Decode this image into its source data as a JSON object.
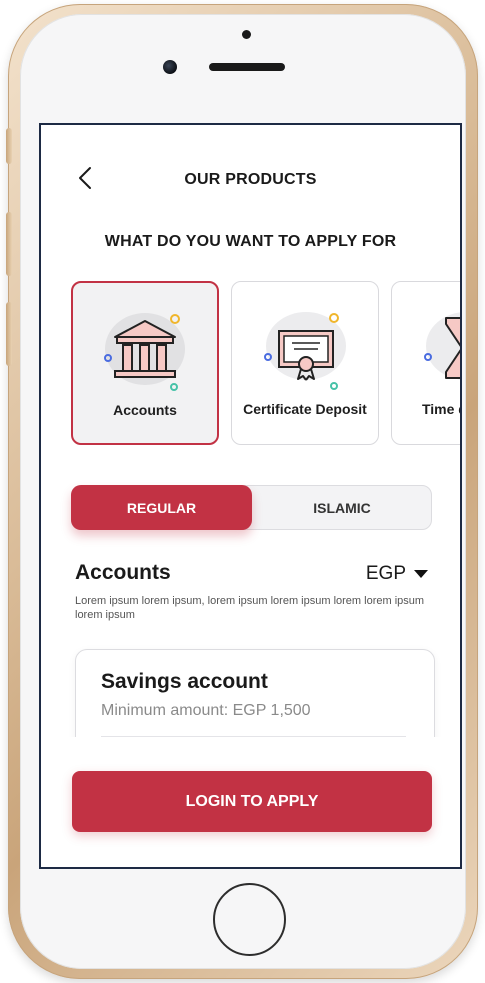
{
  "header": {
    "title": "OUR PRODUCTS",
    "back_icon": "chevron-left-icon"
  },
  "subtitle": "WHAT DO YOU WANT TO APPLY FOR",
  "products": [
    {
      "label": "Accounts",
      "icon": "bank-icon",
      "selected": true
    },
    {
      "label": "Certificate Deposit",
      "icon": "certificate-icon",
      "selected": false
    },
    {
      "label": "Time deposit",
      "visible_label": "T dep",
      "icon": "hourglass-icon",
      "selected": false
    }
  ],
  "segment": {
    "options": [
      "REGULAR",
      "ISLAMIC"
    ],
    "selected": "REGULAR"
  },
  "section": {
    "title": "Accounts",
    "currency": "EGP",
    "description": "Lorem ipsum lorem ipsum, lorem ipsum lorem ipsum lorem lorem ipsum lorem ipsum"
  },
  "account_card": {
    "name": "Savings account",
    "minimum": "Minimum amount: EGP 1,500"
  },
  "cta": {
    "label": "LOGIN TO APPLY"
  },
  "colors": {
    "accent": "#c23244",
    "frame_gold": "#d9bb97",
    "screen_border": "#1d2a44"
  }
}
